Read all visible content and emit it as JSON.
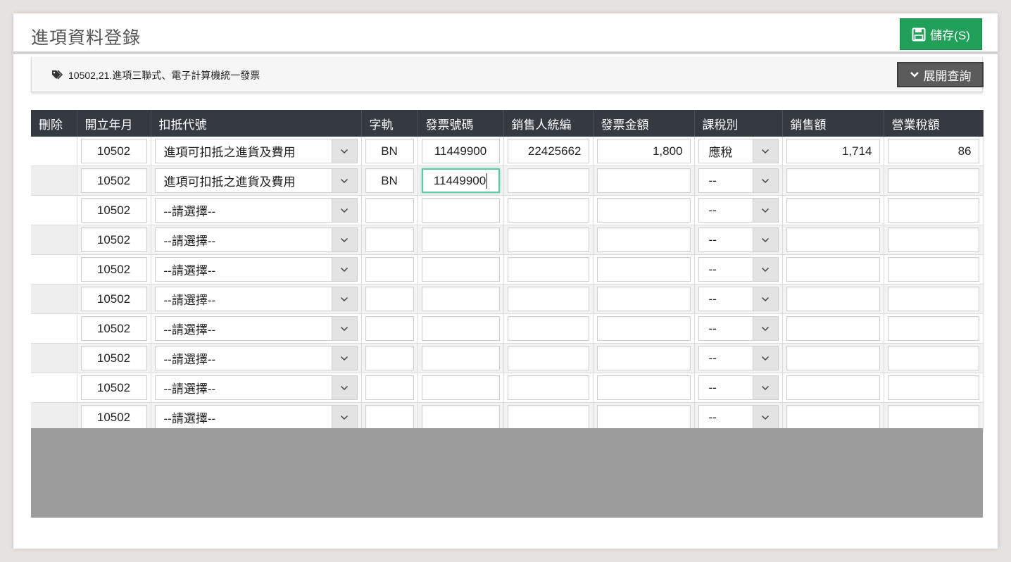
{
  "header": {
    "title": "進項資料登錄",
    "save_label": "儲存(S)"
  },
  "info": {
    "text": "10502,21.進項三聯式、電子計算機統一發票",
    "expand_label": "展開查詢"
  },
  "columns": [
    "刪除",
    "開立年月",
    "扣抵代號",
    "字軌",
    "發票號碼",
    "銷售人統編",
    "發票金額",
    "課稅別",
    "銷售額",
    "營業稅額"
  ],
  "rows": [
    {
      "month": "10502",
      "deduct": "進項可扣抵之進貨及費用",
      "track": "BN",
      "invoice": "11449900",
      "seller_id": "22425662",
      "amount": "1,800",
      "tax_type": "應稅",
      "sales": "1,714",
      "tax": "86"
    },
    {
      "month": "10502",
      "deduct": "進項可扣抵之進貨及費用",
      "track": "BN",
      "invoice": "11449900",
      "seller_id": "",
      "amount": "",
      "tax_type": "--",
      "sales": "",
      "tax": ""
    },
    {
      "month": "10502",
      "deduct": "--請選擇--",
      "track": "",
      "invoice": "",
      "seller_id": "",
      "amount": "",
      "tax_type": "--",
      "sales": "",
      "tax": ""
    },
    {
      "month": "10502",
      "deduct": "--請選擇--",
      "track": "",
      "invoice": "",
      "seller_id": "",
      "amount": "",
      "tax_type": "--",
      "sales": "",
      "tax": ""
    },
    {
      "month": "10502",
      "deduct": "--請選擇--",
      "track": "",
      "invoice": "",
      "seller_id": "",
      "amount": "",
      "tax_type": "--",
      "sales": "",
      "tax": ""
    },
    {
      "month": "10502",
      "deduct": "--請選擇--",
      "track": "",
      "invoice": "",
      "seller_id": "",
      "amount": "",
      "tax_type": "--",
      "sales": "",
      "tax": ""
    },
    {
      "month": "10502",
      "deduct": "--請選擇--",
      "track": "",
      "invoice": "",
      "seller_id": "",
      "amount": "",
      "tax_type": "--",
      "sales": "",
      "tax": ""
    },
    {
      "month": "10502",
      "deduct": "--請選擇--",
      "track": "",
      "invoice": "",
      "seller_id": "",
      "amount": "",
      "tax_type": "--",
      "sales": "",
      "tax": ""
    },
    {
      "month": "10502",
      "deduct": "--請選擇--",
      "track": "",
      "invoice": "",
      "seller_id": "",
      "amount": "",
      "tax_type": "--",
      "sales": "",
      "tax": ""
    },
    {
      "month": "10502",
      "deduct": "--請選擇--",
      "track": "",
      "invoice": "",
      "seller_id": "",
      "amount": "",
      "tax_type": "--",
      "sales": "",
      "tax": ""
    }
  ],
  "colors": {
    "save_button": "#21a05a",
    "table_header": "#343a40",
    "focus_border": "#5cc9a7",
    "footer_band": "#9c9c9c"
  }
}
